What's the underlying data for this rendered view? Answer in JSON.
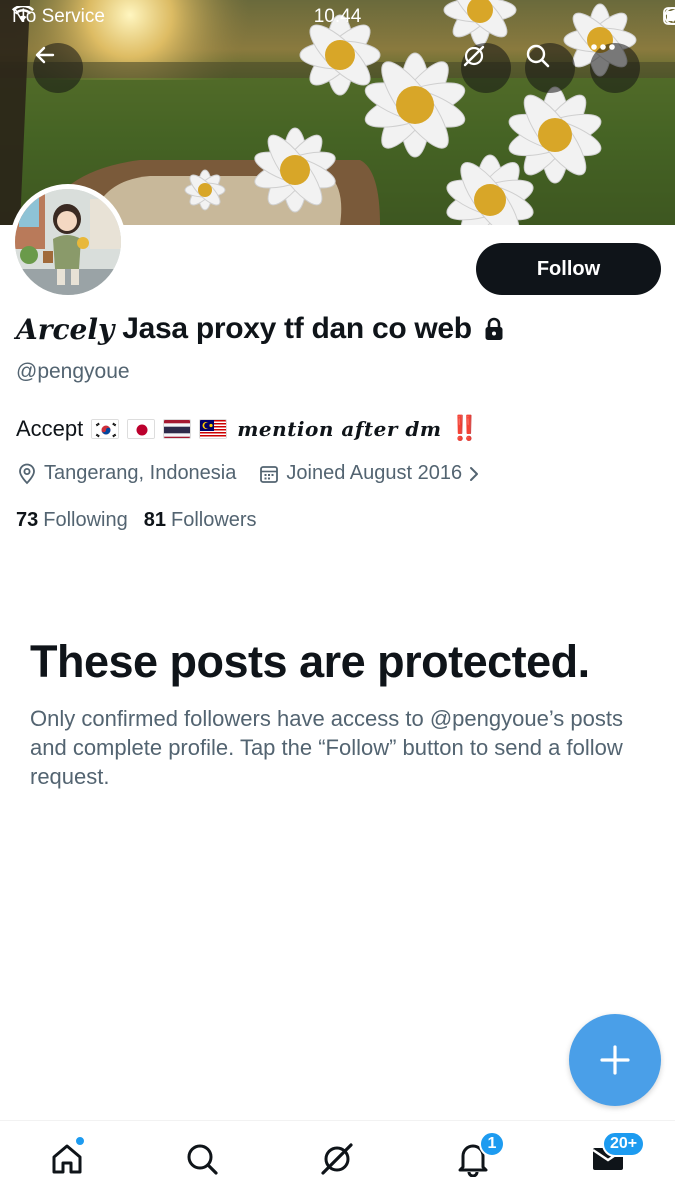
{
  "status_bar": {
    "carrier": "No Service",
    "time": "10.44"
  },
  "profile": {
    "display_name_script": "Arcely",
    "display_name": "Jasa proxy tf dan co web",
    "handle": "@pengyoue",
    "follow_label": "Follow",
    "bio_prefix": "Accept",
    "bio_flags": [
      "south-korea-flag",
      "japan-flag",
      "thailand-flag",
      "malaysia-flag"
    ],
    "bio_script": "mention after dm",
    "bio_suffix": "‼️",
    "location": "Tangerang, Indonesia",
    "joined": "Joined August 2016",
    "following_count": "73",
    "following_label": "Following",
    "followers_count": "81",
    "followers_label": "Followers"
  },
  "protected": {
    "title": "These posts are protected.",
    "description": "Only confirmed followers have access to @pengyoue’s posts and complete profile. Tap the “Follow” button to send a follow request."
  },
  "tab_bar": {
    "notifications_badge": "1",
    "messages_badge": "20+"
  },
  "colors": {
    "accent": "#1d9bf0",
    "fab": "#4a9fe8",
    "text_primary": "#0f1419",
    "text_secondary": "#536471"
  }
}
